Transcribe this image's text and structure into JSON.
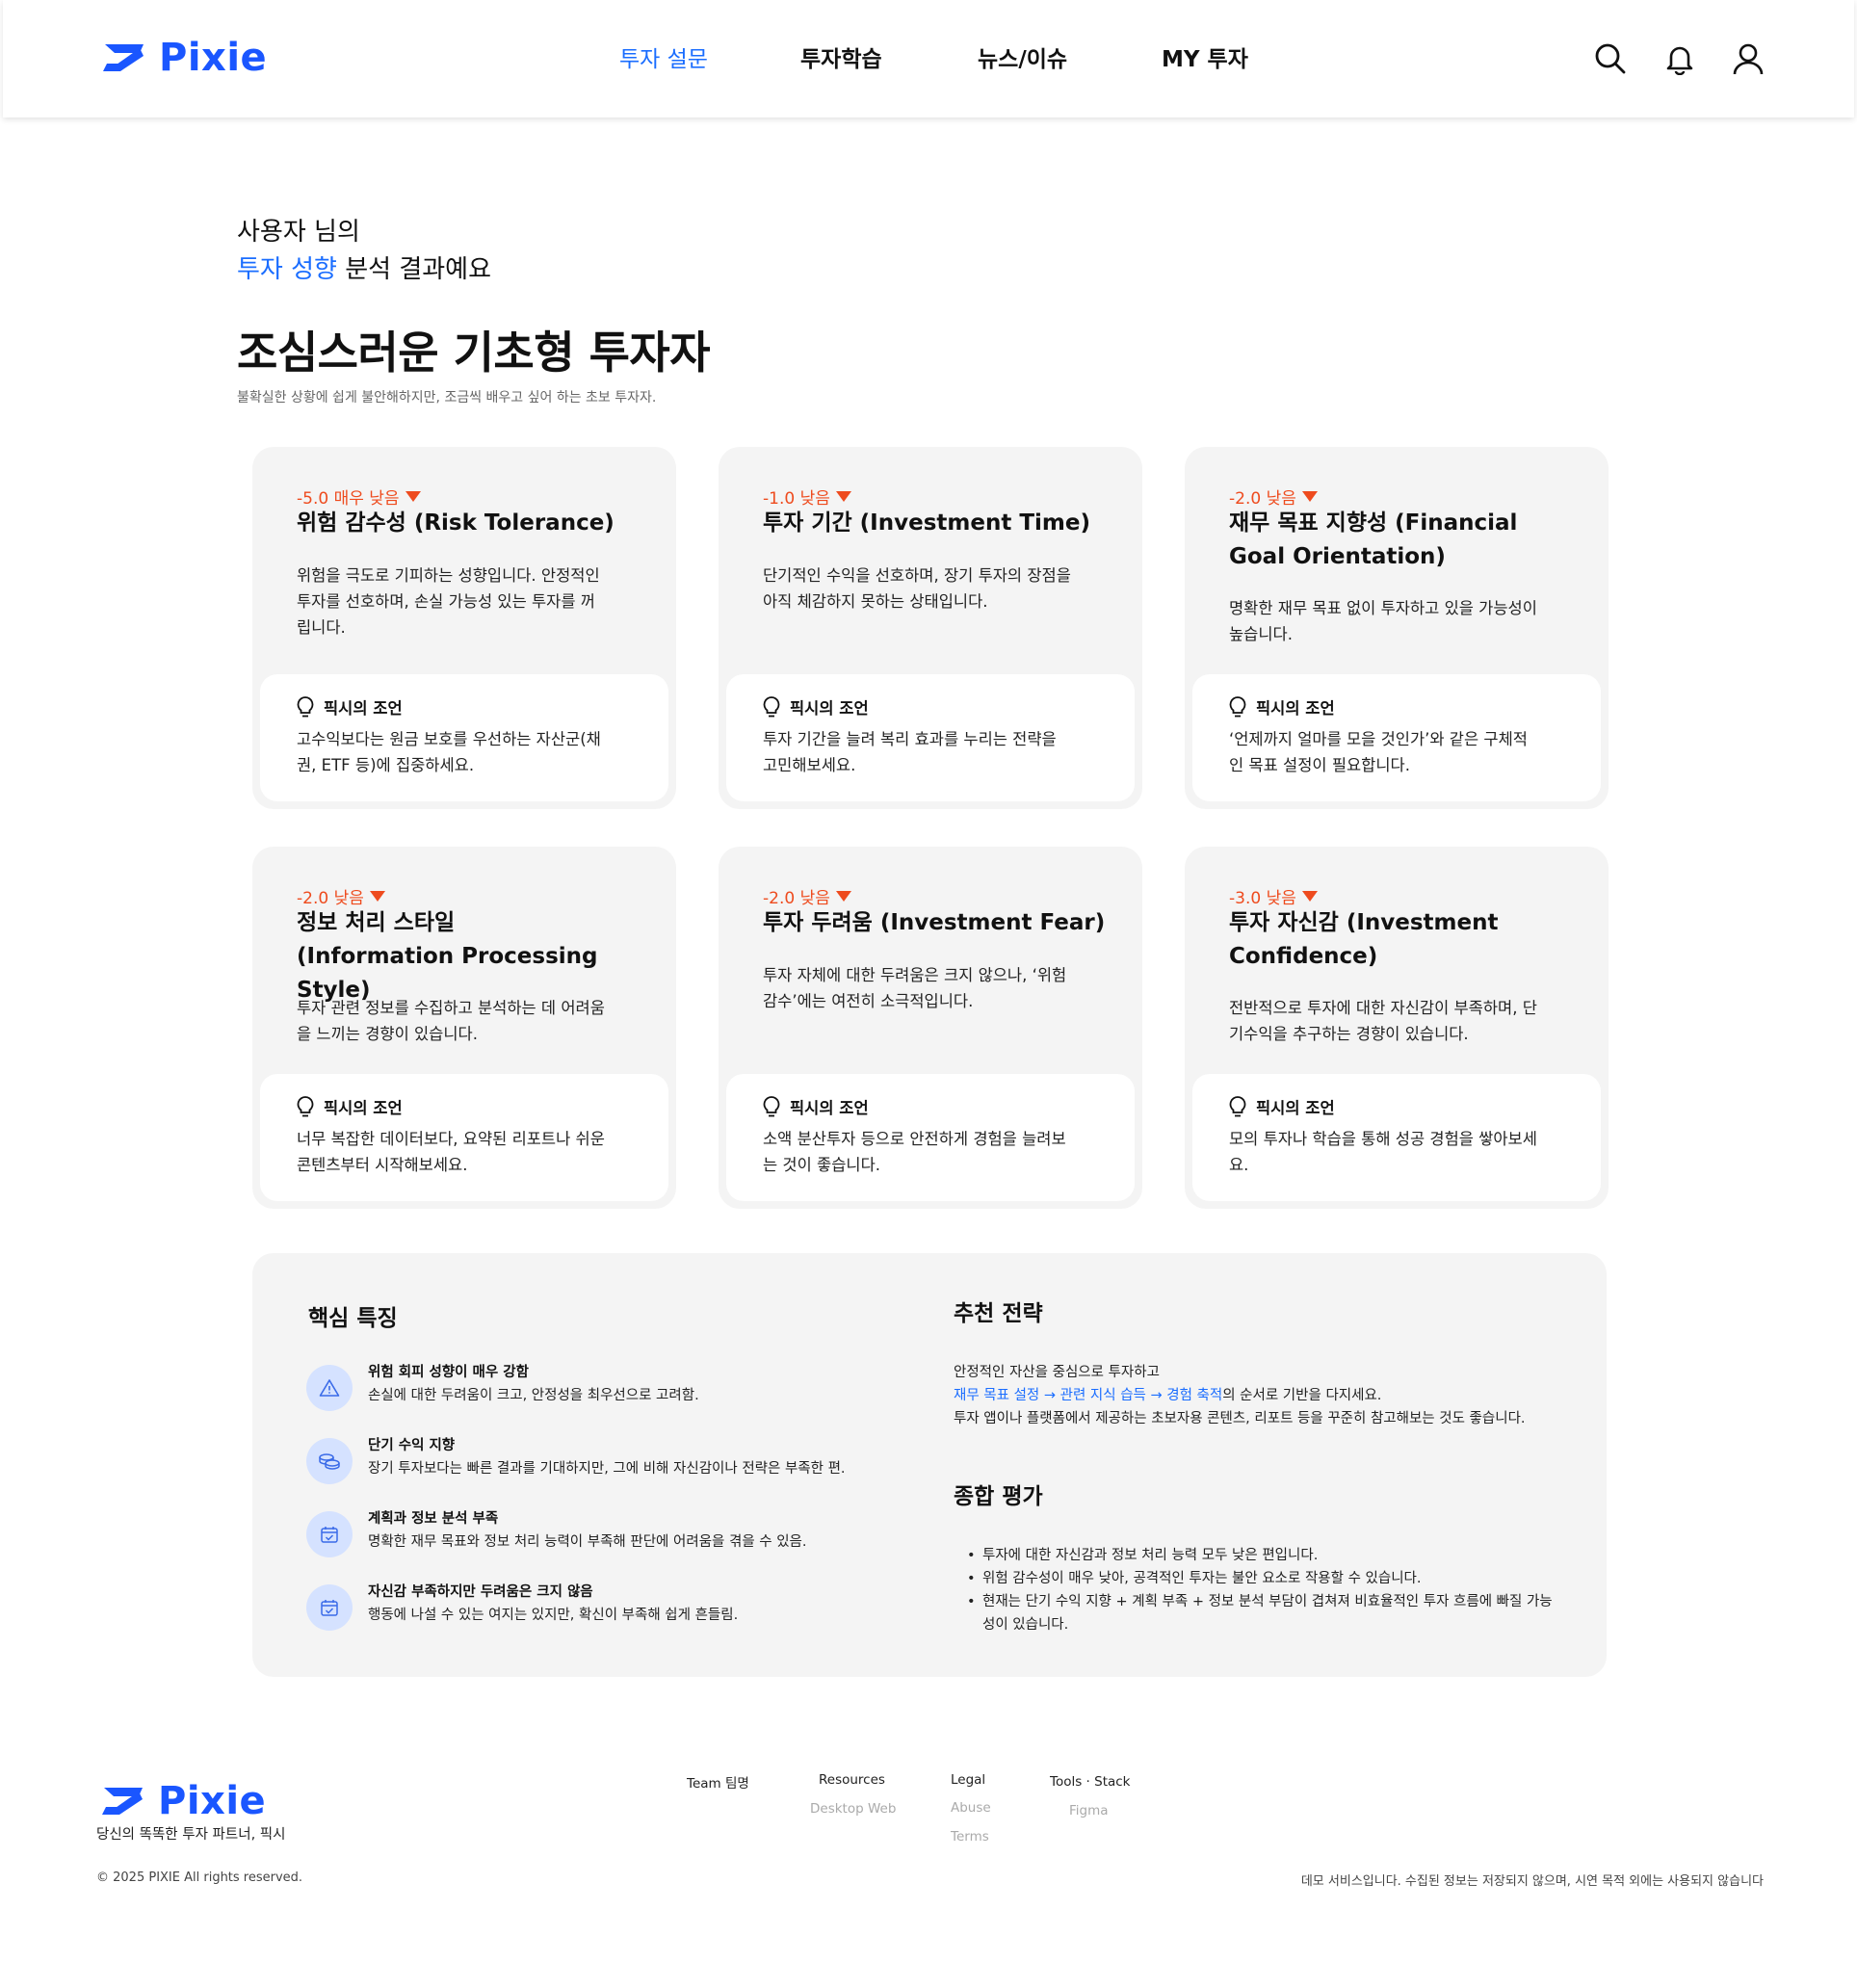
{
  "brand": {
    "name": "Pixie",
    "color": "#1a56ff",
    "accent": "#1a6dff",
    "warning": "#ee4b1e"
  },
  "nav": {
    "items": [
      {
        "label": "투자 설문",
        "active": true
      },
      {
        "label": "투자학습",
        "active": false
      },
      {
        "label": "뉴스/이슈",
        "active": false
      },
      {
        "label": "MY 투자",
        "active": false
      }
    ],
    "icons": [
      "search-icon",
      "bell-icon",
      "user-icon"
    ]
  },
  "hero": {
    "greeting_line1": "사용자 님의",
    "greeting_accent": "투자 성향",
    "greeting_rest": " 분석 결과예요",
    "type_title": "조심스러운 기초형 투자자",
    "type_desc": "불확실한 상황에 쉽게 불안해하지만, 조금씩 배우고 싶어 하는 초보 투자자."
  },
  "cards": [
    {
      "score": "-5.0 매우 낮음",
      "title": "위험 감수성 (Risk Tolerance)",
      "desc": "위험을 극도로 기피하는 성향입니다. 안정적인 투자를 선호하며, 손실 가능성 있는 투자를 꺼립니다.",
      "advice_label": "픽시의 조언",
      "advice": "고수익보다는 원금 보호를 우선하는 자산군(채권, ETF 등)에 집중하세요."
    },
    {
      "score": "-1.0 낮음",
      "title": "투자 기간 (Investment Time)",
      "desc": "단기적인 수익을 선호하며, 장기 투자의 장점을 아직 체감하지 못하는 상태입니다.",
      "advice_label": "픽시의 조언",
      "advice": "투자 기간을 늘려 복리 효과를 누리는 전략을 고민해보세요."
    },
    {
      "score": "-2.0 낮음",
      "title": "재무 목표 지향성 (Financial Goal Orientation)",
      "desc": "명확한 재무 목표 없이 투자하고 있을 가능성이 높습니다.",
      "advice_label": "픽시의 조언",
      "advice": "‘언제까지 얼마를 모을 것인가’와 같은 구체적인 목표 설정이 필요합니다."
    },
    {
      "score": "-2.0 낮음",
      "title": "정보 처리 스타일 (Information Processing Style)",
      "desc": "투자 관련 정보를 수집하고 분석하는 데 어려움을 느끼는 경향이 있습니다.",
      "advice_label": "픽시의 조언",
      "advice": "너무 복잡한 데이터보다, 요약된 리포트나 쉬운 콘텐츠부터 시작해보세요."
    },
    {
      "score": "-2.0 낮음",
      "title": "투자 두려움 (Investment Fear)",
      "desc": "투자 자체에 대한 두려움은 크지 않으나, ‘위험 감수’에는 여전히 소극적입니다.",
      "advice_label": "픽시의 조언",
      "advice": "소액 분산투자 등으로 안전하게 경험을 늘려보는 것이 좋습니다."
    },
    {
      "score": "-3.0 낮음",
      "title": "투자 자신감 (Investment Confidence)",
      "desc": "전반적으로 투자에 대한 자신감이 부족하며, 단기수익을 추구하는 경향이 있습니다.",
      "advice_label": "픽시의 조언",
      "advice": "모의 투자나 학습을 통해 성공 경험을 쌓아보세요."
    }
  ],
  "summary": {
    "features_title": "핵심 특징",
    "features": [
      {
        "icon": "warning-icon",
        "title": "위험 회피 성향이 매우 강함",
        "desc": "손실에 대한 두려움이 크고, 안정성을 최우선으로 고려함."
      },
      {
        "icon": "coins-icon",
        "title": "단기 수익 지향",
        "desc": "장기 투자보다는 빠른 결과를 기대하지만, 그에 비해 자신감이나 전략은 부족한 편."
      },
      {
        "icon": "calendar-check-icon",
        "title": "계획과 정보 분석 부족",
        "desc": "명확한 재무 목표와 정보 처리 능력이 부족해 판단에 어려움을 겪을 수 있음."
      },
      {
        "icon": "calendar-check-icon",
        "title": "자신감 부족하지만 두려움은 크지 않음",
        "desc": "행동에 나설 수 있는 여지는 있지만, 확신이 부족해 쉽게 흔들림."
      }
    ],
    "strategy_title": "추천 전략",
    "strategy_line1": "안정적인 자산을 중심으로 투자하고",
    "strategy_flow": "재무 목표 설정 → 관련 지식 습득 → 경험 축적",
    "strategy_flow_rest": "의 순서로 기반을 다지세요.",
    "strategy_line3": "투자 앱이나 플랫폼에서 제공하는 초보자용 콘텐츠, 리포트 등을 꾸준히 참고해보는 것도 좋습니다.",
    "eval_title": "종합 평가",
    "eval_items": [
      "투자에 대한 자신감과 정보 처리 능력 모두 낮은 편입니다.",
      "위험 감수성이 매우 낮아, 공격적인 투자는 불안 요소로 작용할 수 있습니다.",
      "현재는 단기 수익 지향 + 계획 부족 + 정보 분석 부담이 겹쳐져 비효율적인 투자 흐름에 빠질 가능성이 있습니다."
    ]
  },
  "footer": {
    "tagline": "당신의 똑똑한 투자 파트너, 픽시",
    "columns": [
      {
        "heading": "Team 팀명",
        "links": []
      },
      {
        "heading": "Resources",
        "links": [
          "Desktop Web"
        ]
      },
      {
        "heading": "Legal",
        "links": [
          "Abuse",
          "Terms"
        ]
      },
      {
        "heading": "Tools · Stack",
        "links": [
          "Figma"
        ]
      }
    ],
    "copyright": "© 2025 PIXIE All rights reserved.",
    "demo_notice": "데모 서비스입니다. 수집된 정보는 저장되지 않으며, 시연 목적 외에는 사용되지 않습니다"
  }
}
